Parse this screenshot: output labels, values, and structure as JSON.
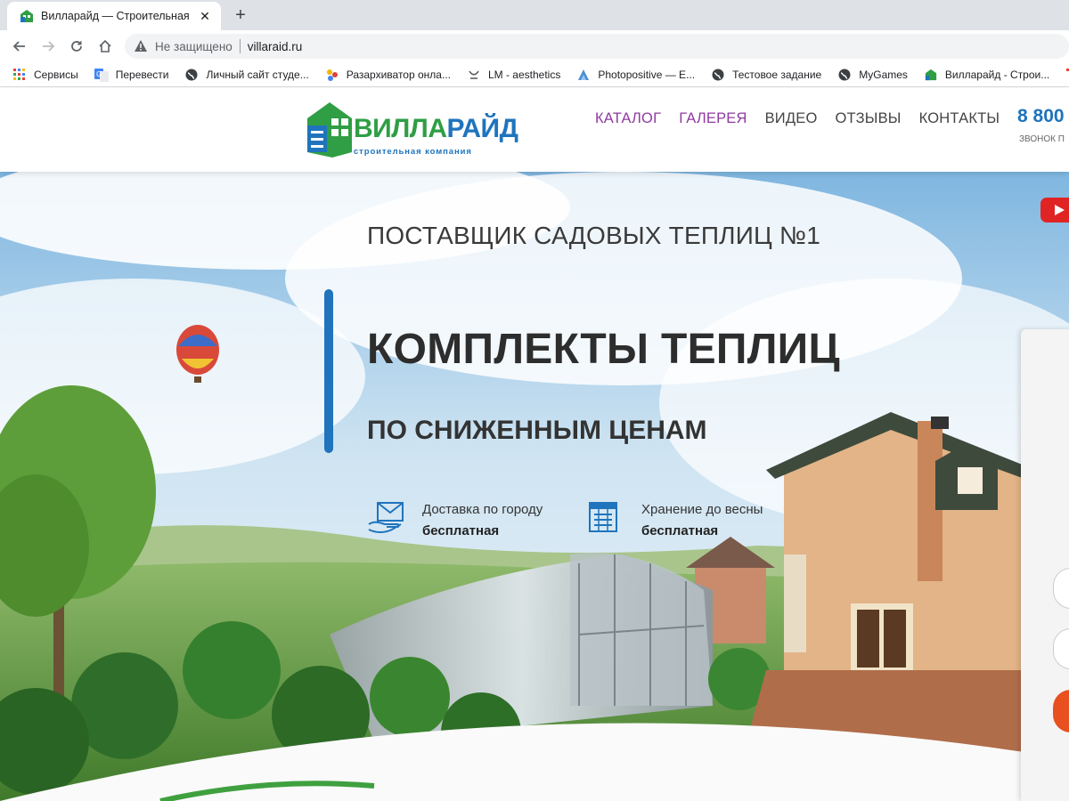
{
  "browser": {
    "tab_title": "Вилларайд — Строительная ком",
    "security_label": "Не защищено",
    "url": "villaraid.ru",
    "bookmarks": [
      {
        "label": "Сервисы",
        "icon": "apps-grid-icon"
      },
      {
        "label": "Перевести",
        "icon": "google-translate-icon"
      },
      {
        "label": "Личный сайт студе...",
        "icon": "globe-icon"
      },
      {
        "label": "Разархиватор онла...",
        "icon": "dots-app-icon"
      },
      {
        "label": "LM - aesthetics",
        "icon": "lm-icon"
      },
      {
        "label": "Photopositive — E...",
        "icon": "photopositive-icon"
      },
      {
        "label": "Тестовое задание",
        "icon": "globe-icon"
      },
      {
        "label": "MyGames",
        "icon": "globe-icon"
      },
      {
        "label": "Вилларайд - Строи...",
        "icon": "villaraid-favicon-icon"
      },
      {
        "label": "У",
        "icon": "apps-grid-icon"
      }
    ]
  },
  "site": {
    "logo": {
      "word1": "ВИЛЛА",
      "word2": "РАЙД",
      "tagline": "строительная компания"
    },
    "nav": [
      {
        "label": "КАТАЛОГ",
        "color": "#8e3aa0"
      },
      {
        "label": "ГАЛЕРЕЯ",
        "color": "#8e3aa0"
      },
      {
        "label": "ВИДЕО",
        "color": "#444444"
      },
      {
        "label": "ОТЗЫВЫ",
        "color": "#444444"
      },
      {
        "label": "КОНТАКТЫ",
        "color": "#444444"
      }
    ],
    "phone": "8 800",
    "phone_sub": "ЗВОНОК П"
  },
  "hero": {
    "eyebrow": "ПОСТАВЩИК САДОВЫХ ТЕПЛИЦ №1",
    "headline": "КОМПЛЕКТЫ ТЕПЛИЦ",
    "subline": "ПО СНИЖЕННЫМ ЦЕНАМ",
    "features": [
      {
        "title": "Доставка по городу",
        "value": "бесплатная",
        "icon": "delivery-envelope-icon"
      },
      {
        "title": "Хранение до весны",
        "value": "бесплатная",
        "icon": "storage-calendar-icon"
      }
    ]
  },
  "colors": {
    "brand_green": "#2f9e44",
    "brand_blue": "#1f74bd",
    "cta": "#e8501f"
  }
}
